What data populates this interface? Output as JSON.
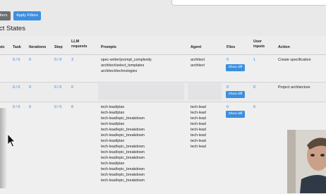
{
  "filters": {
    "clear_label": "ilters",
    "apply_label": "Apply Filters"
  },
  "title": "ct States",
  "columns": [
    "pic",
    "Task",
    "Iterations",
    "Step",
    "LLM requests",
    "Prompts",
    "Agent",
    "Files",
    "User inputs",
    "Action"
  ],
  "rows": [
    {
      "task": "0 / 0",
      "iterations": "0",
      "step": "0 / 0",
      "llm_requests": "3",
      "prompts": [
        "spec-writer/prompt_complexity",
        "architect/select_templates",
        "architect/technologies"
      ],
      "agents": [
        "architect",
        "architect"
      ],
      "files": "0",
      "show_diff": "Show diff",
      "user_inputs": "1",
      "action": "Create specification"
    },
    {
      "task": "0 / 0",
      "iterations": "0",
      "step": "0 / 0",
      "llm_requests": "0",
      "prompts": [],
      "agents": [],
      "files": "0",
      "show_diff": "Show diff",
      "user_inputs": "0",
      "action": "Project architecture"
    },
    {
      "task": "0 / 0",
      "iterations": "0",
      "step": "0 / 0",
      "llm_requests": "8",
      "prompts": [
        "tech-lead/plan",
        "tech-lead/plan",
        "tech-lead/epic_breakdown",
        "tech-lead/plan",
        "tech-lead/epic_breakdown",
        "tech-lead/epic_breakdown",
        "tech-lead/plan",
        "tech-lead/epic_breakdown",
        "tech-lead/epic_breakdown",
        "tech-lead/epic_breakdown",
        "tech-lead/plan",
        "tech-lead/epic_breakdown",
        "tech-lead/epic_breakdown",
        "tech-lead/epic_breakdown"
      ],
      "agents": [
        "tech-lead",
        "tech-lead",
        "tech-lead",
        "tech-lead",
        "tech-lead",
        "tech-lead",
        "tech-lead",
        "tech-lead"
      ],
      "files": "0",
      "show_diff": "Show diff",
      "user_inputs": "0",
      "action": ""
    }
  ],
  "colors": {
    "accent": "#3c8fe0",
    "link": "#2f7fd8"
  },
  "icons": [
    "mouse-cursor-icon"
  ]
}
